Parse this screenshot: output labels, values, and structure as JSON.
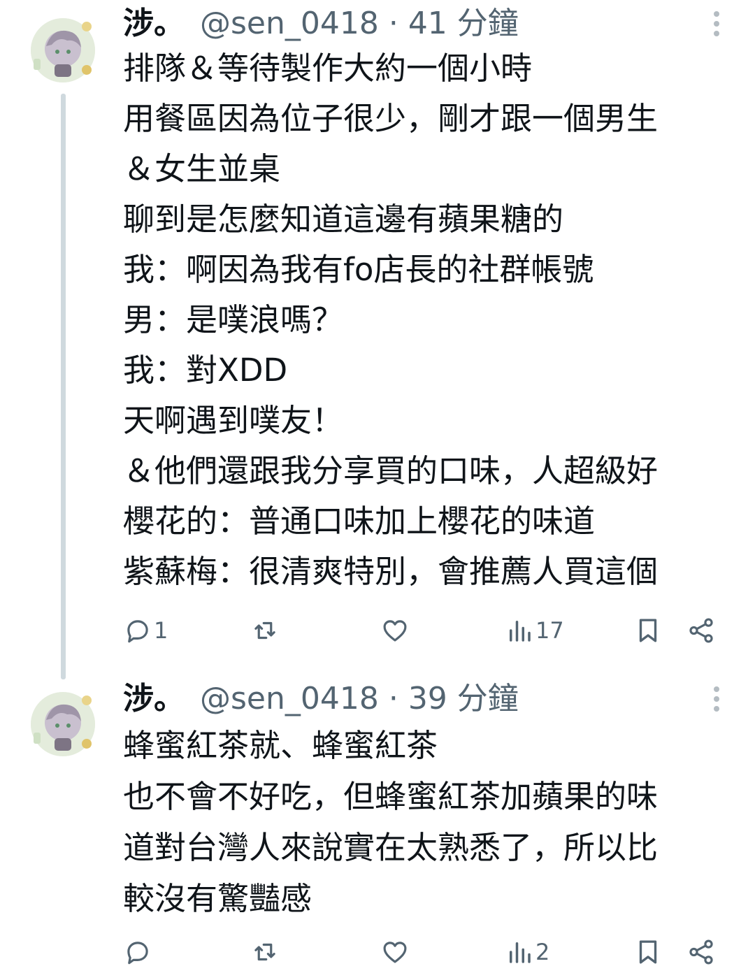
{
  "tweets": [
    {
      "display_name": "涉。",
      "meta": "@sen_0418 · 41 分鐘",
      "lines": [
        "排隊＆等待製作大約一個小時",
        "用餐區因為位子很少，剛才跟一個男生",
        "＆女生並桌",
        "聊到是怎麼知道這邊有蘋果糖的",
        "我：啊因為我有fo店長的社群帳號",
        "男：是噗浪嗎？",
        "我：對XDD",
        "天啊遇到噗友！",
        "＆他們還跟我分享買的口味，人超級好",
        "櫻花的：普通口味加上櫻花的味道",
        "紫蘇梅：很清爽特別，會推薦人買這個"
      ],
      "reply_count": "1",
      "repost_count": "",
      "like_count": "",
      "views_count": "17"
    },
    {
      "display_name": "涉。",
      "meta": "@sen_0418 · 39 分鐘",
      "lines": [
        "蜂蜜紅茶就、蜂蜜紅茶",
        "也不會不好吃，但蜂蜜紅茶加蘋果的味",
        "道對台灣人來說實在太熟悉了，所以比",
        "較沒有驚豔感"
      ],
      "reply_count": "",
      "repost_count": "",
      "like_count": "",
      "views_count": "2"
    }
  ],
  "icons": {
    "reply": "speech-bubble-icon",
    "repost": "repost-arrows-icon",
    "like": "heart-icon",
    "views": "bar-chart-icon",
    "bookmark": "bookmark-icon",
    "share": "share-nodes-icon",
    "more": "vertical-dots-icon"
  },
  "colors": {
    "text": "#0f1419",
    "secondary": "#536471",
    "thread_line": "#cfd9de"
  }
}
